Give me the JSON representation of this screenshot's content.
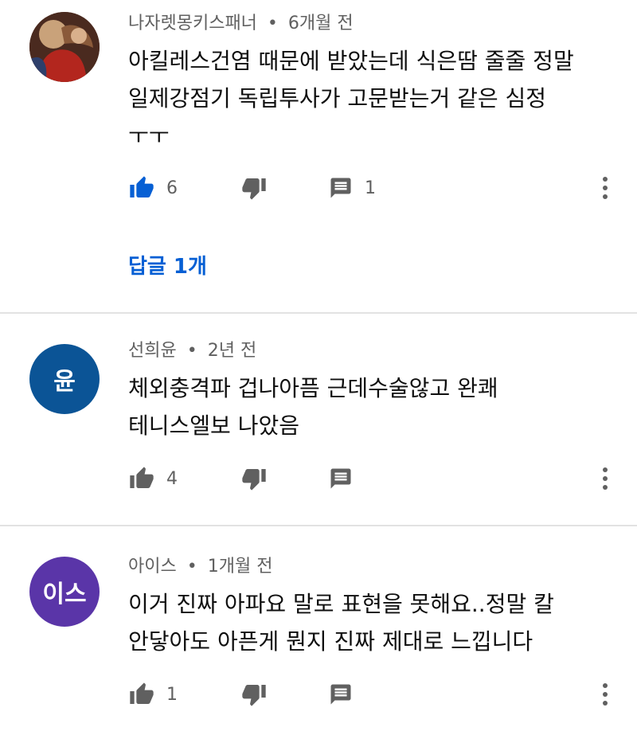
{
  "comments": [
    {
      "author": "나자렛몽키스패너",
      "time": "6개월 전",
      "text": "아킬레스건염 때문에 받았는데 식은땀 줄줄  정말\n일제강점기 독립투사가 고문받는거 같은 심정\nㅜㅜ",
      "likes": "6",
      "replies_count": "1",
      "liked": true,
      "replies_label": "답글 1개",
      "avatar_icon": "painting-avatar"
    },
    {
      "author": "선희윤",
      "time": "2년 전",
      "text": "체외충격파  겁나아픔 근데수술않고 완쾌\n테니스엘보 나았음",
      "likes": "4",
      "liked": false,
      "avatar_letter": "윤",
      "avatar_color": "#0b5496"
    },
    {
      "author": "아이스",
      "time": "1개월 전",
      "text": "이거 진짜 아파요 말로 표현을 못해요..정말 칼\n안닿아도 아픈게 뭔지 진짜 제대로 느낍니다",
      "likes": "1",
      "liked": false,
      "avatar_letter": "이스",
      "avatar_color": "#5a35a8"
    }
  ],
  "ui": {
    "separator": "•"
  },
  "colors": {
    "accent": "#065fd4",
    "icon": "#606060"
  }
}
